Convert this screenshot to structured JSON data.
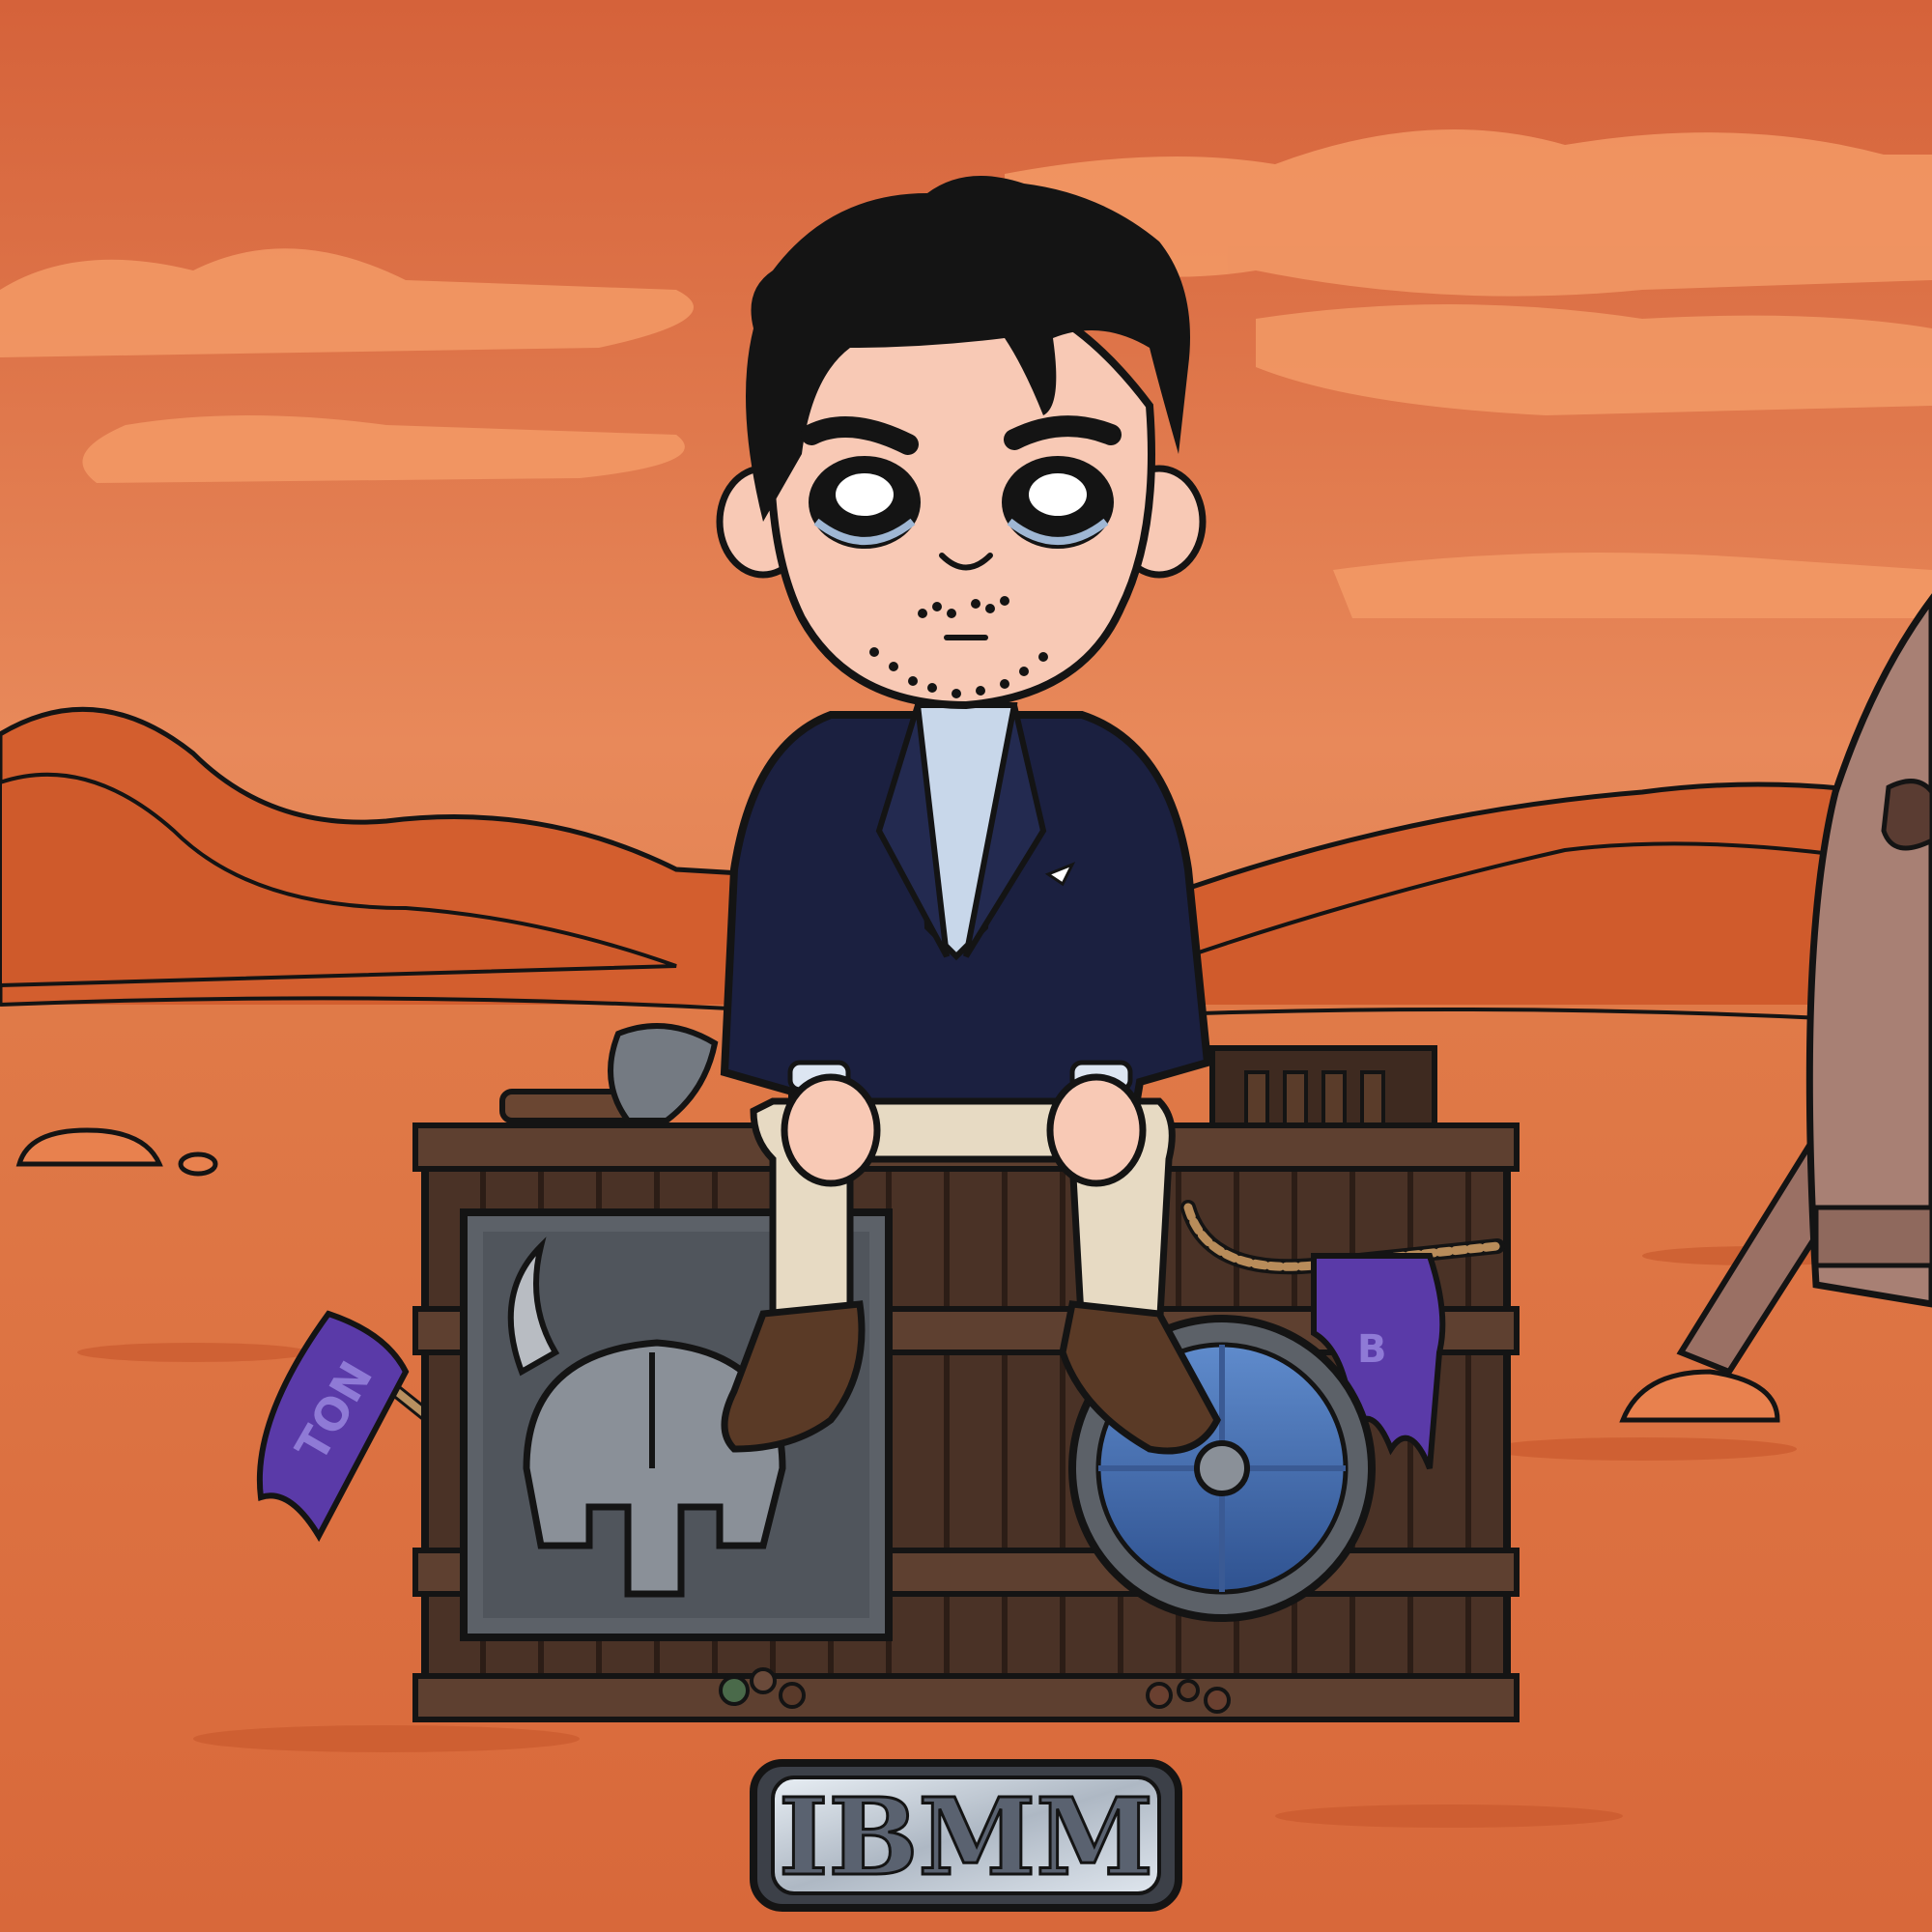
{
  "scene": {
    "colors": {
      "sky_top": "#d8663c",
      "sky_bottom": "#e88a5a",
      "cloud": "#f6a06a",
      "ground": "#dc6f3e",
      "hills": "#d5612f",
      "outline": "#141414",
      "skin": "#f8c9b5",
      "hair": "#141414",
      "jacket": "#1b2040",
      "shirt": "#c8d7ea",
      "pants": "#e7dac3",
      "shoes": "#5a3a26",
      "crate": "#4a3226",
      "crate_slat": "#5e4030",
      "steel": "#5c6168",
      "shield_blue": "#4e78b8",
      "banner_purple": "#5a3aa8",
      "rocket": "#a07a6e"
    }
  },
  "items": {
    "helmet_icon": "viking-helmet-icon",
    "axe_icon": "battle-axe-icon",
    "shield_icon": "round-shield-icon",
    "flag_left_text": "TON",
    "flag_right_text": "B"
  },
  "nameplate": {
    "text": "IBMM"
  }
}
